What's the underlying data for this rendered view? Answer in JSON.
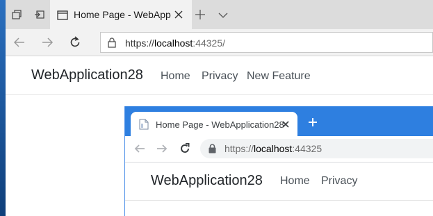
{
  "edge": {
    "tab": {
      "title": "Home Page - WebAppli"
    },
    "address": {
      "scheme": "https://",
      "host": "localhost",
      "port": ":44325/"
    },
    "site": {
      "brand": "WebApplication28",
      "nav": [
        "Home",
        "Privacy",
        "New Feature"
      ]
    }
  },
  "chrome": {
    "tab": {
      "title": "Home Page - WebApplication28"
    },
    "address": {
      "scheme": "https://",
      "host": "localhost",
      "port": ":44325"
    },
    "site": {
      "brand": "WebApplication28",
      "nav": [
        "Home",
        "Privacy"
      ]
    }
  },
  "icons": {
    "edge_tab_preview": "tab-preview-icon",
    "edge_set_aside": "set-aside-tabs-icon",
    "page_favicon": "page-icon",
    "close": "close-icon",
    "new_tab": "plus-icon",
    "tab_dropdown": "chevron-down-icon",
    "back": "back-arrow-icon",
    "forward": "forward-arrow-icon",
    "refresh": "refresh-icon",
    "lock": "lock-icon"
  },
  "colors": {
    "chrome_titlebar": "#2e7fe0",
    "edge_tabbar": "#dcdcdc",
    "desktop": "#1f5fa6"
  }
}
